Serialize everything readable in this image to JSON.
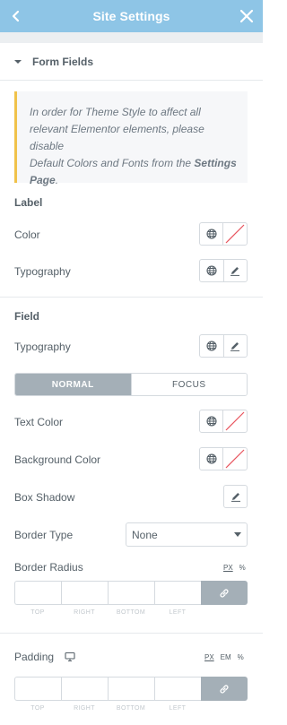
{
  "header": {
    "title": "Site Settings"
  },
  "section": {
    "title": "Form Fields"
  },
  "notice": {
    "line1": "In order for Theme Style to affect all",
    "line2": "relevant Elementor elements, please disable",
    "line3_pre": "Default Colors and Fonts from the ",
    "line3_bold": "Settings",
    "line4_bold": "Page",
    "line4_post": "."
  },
  "label_group": {
    "title": "Label",
    "color": "Color",
    "typography": "Typography"
  },
  "field_group": {
    "title": "Field",
    "typography": "Typography",
    "tabs": {
      "normal": "NORMAL",
      "focus": "FOCUS"
    },
    "text_color": "Text Color",
    "background_color": "Background Color",
    "box_shadow": "Box Shadow",
    "border_type": "Border Type",
    "border_type_value": "None",
    "border_radius": "Border Radius",
    "border_radius_units": [
      "PX",
      "%"
    ],
    "padding": "Padding",
    "padding_units": [
      "PX",
      "EM",
      "%"
    ],
    "dimensions": [
      "TOP",
      "RIGHT",
      "BOTTOM",
      "LEFT"
    ]
  },
  "colors": {
    "header_bg": "#8ec5e6",
    "notice_accent": "#f0c24a",
    "active_tab": "#a4afb7",
    "empty_swatch_line": "#e8545e"
  },
  "icons": [
    "chevron-left-icon",
    "close-icon",
    "caret-down-icon",
    "globe-icon",
    "pencil-icon",
    "link-icon",
    "desktop-icon"
  ]
}
